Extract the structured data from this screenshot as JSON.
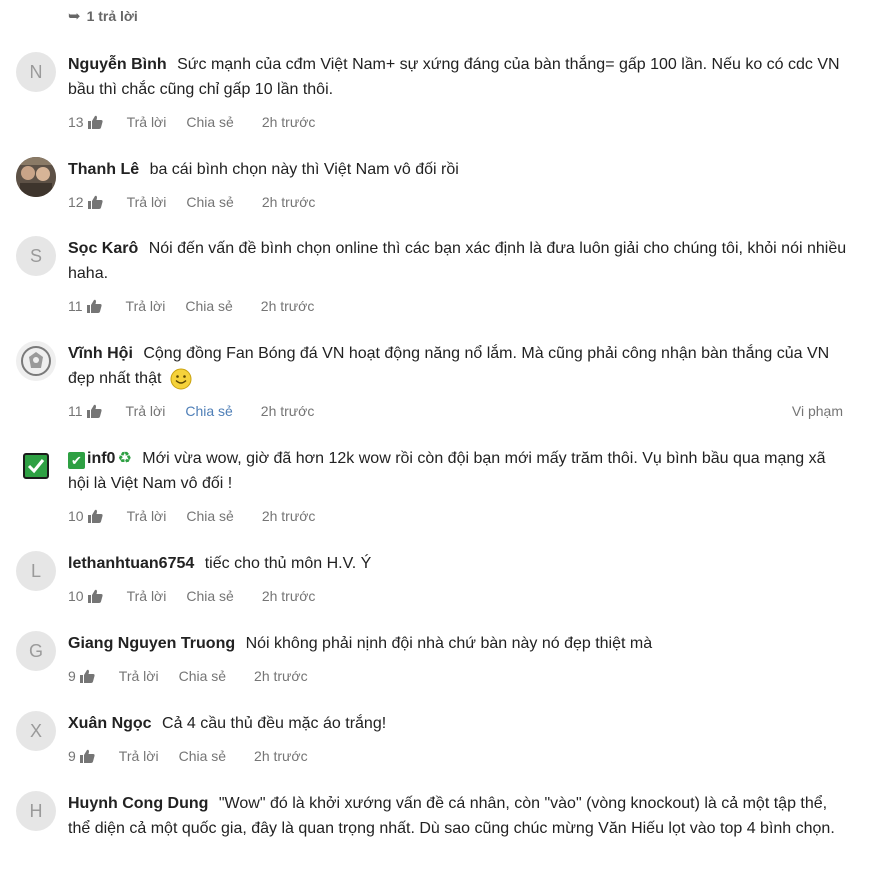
{
  "reply_toggle": {
    "icon": "reply-arrow-icon",
    "label": "1 trả lời"
  },
  "actions": {
    "reply": "Trả lời",
    "share": "Chia sẻ",
    "report": "Vi phạm"
  },
  "comments": [
    {
      "initial": "N",
      "author": "Nguyễn Bình",
      "text": "Sức mạnh của cđm Việt Nam+ sự xứng đáng của bàn thắng= gấp 100 lần. Nếu ko có cdc VN bầu thì chắc cũng chỉ gấp 10 lần thôi.",
      "likes": "13",
      "time": "2h trước"
    },
    {
      "initial": "",
      "author": "Thanh Lê",
      "text": "ba cái bình chọn này thì Việt Nam vô đối rồi",
      "likes": "12",
      "time": "2h trước"
    },
    {
      "initial": "S",
      "author": "Sọc Karô",
      "text": "Nói đến vấn đề bình chọn online thì các bạn xác định là đưa luôn giải cho chúng tôi, khỏi nói nhiều haha.",
      "likes": "11",
      "time": "2h trước"
    },
    {
      "initial": "",
      "author": "Vĩnh Hội",
      "text": "Cộng đồng Fan Bóng đá VN hoạt động năng nổ lắm. Mà cũng phải công nhận bàn thắng của VN đẹp nhất thật",
      "likes": "11",
      "time": "2h trước"
    },
    {
      "initial": "",
      "author": "inf0",
      "text": "Mới vừa wow, giờ đã hơn 12k wow rồi còn đội bạn mới mấy trăm thôi. Vụ bình bầu qua mạng xã hội là Việt Nam vô đối !",
      "likes": "10",
      "time": "2h trước"
    },
    {
      "initial": "L",
      "author": "lethanhtuan6754",
      "text": "tiếc cho thủ môn H.V. Ý",
      "likes": "10",
      "time": "2h trước"
    },
    {
      "initial": "G",
      "author": "Giang Nguyen Truong",
      "text": "Nói không phải nịnh đội nhà chứ bàn này nó đẹp thiệt mà",
      "likes": "9",
      "time": "2h trước"
    },
    {
      "initial": "X",
      "author": "Xuân Ngọc",
      "text": "Cả 4 cầu thủ đều mặc áo trắng!",
      "likes": "9",
      "time": "2h trước"
    },
    {
      "initial": "H",
      "author": "Huynh Cong Dung",
      "text": "\"Wow\" đó là khởi xướng vấn đề cá nhân, còn \"vào\" (vòng knockout) là cả một tập thể, thể diện cả một quốc gia, đây là quan trọng nhất. Dù sao cũng chúc mừng Văn Hiếu lọt vào top 4 bình chọn.",
      "likes": "",
      "time": ""
    }
  ],
  "colors": {
    "text": "#222222",
    "meta": "#757575",
    "link_hover": "#4f7fb7",
    "avatar_bg": "#e6e6e6"
  }
}
